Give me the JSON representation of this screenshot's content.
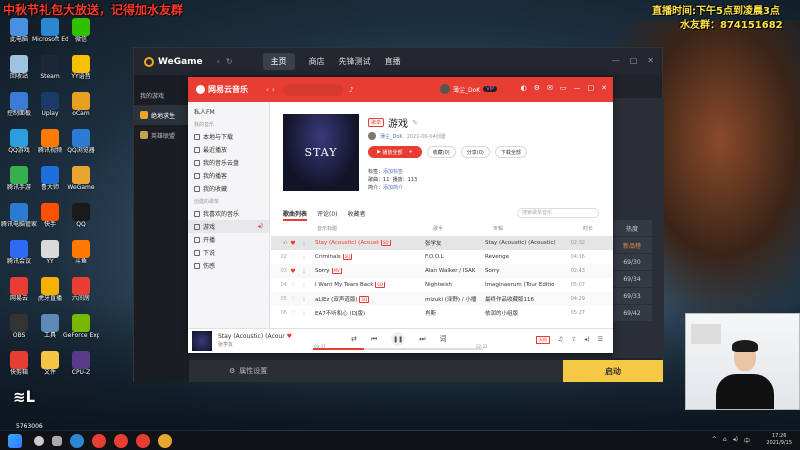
{
  "overlay": {
    "top_left": "中秋节礼包大放送，记得加水友群",
    "top_right_line1": "直播时间:下午5点到凌晨3点",
    "top_right_line2": "水友群：874151682"
  },
  "desktop_icons": [
    {
      "label": "此电脑",
      "icon": "computer-icon",
      "color": "#4a90e2"
    },
    {
      "label": "Microsoft Edge",
      "icon": "edge-icon",
      "color": "#2b87d1"
    },
    {
      "label": "微信",
      "icon": "wechat-icon",
      "color": "#2dc100"
    },
    {
      "label": "回收站",
      "icon": "recycle-bin-icon",
      "color": "#9ec3e0"
    },
    {
      "label": "Steam",
      "icon": "steam-icon",
      "color": "#1b2838"
    },
    {
      "label": "YY语音",
      "icon": "yy-icon",
      "color": "#f5c000"
    },
    {
      "label": "控制面板",
      "icon": "control-panel-icon",
      "color": "#3a7bd5"
    },
    {
      "label": "Uplay",
      "icon": "uplay-icon",
      "color": "#1a3a6a"
    },
    {
      "label": "oCam",
      "icon": "ocam-icon",
      "color": "#e8a020"
    },
    {
      "label": "QQ游戏",
      "icon": "qq-game-icon",
      "color": "#2a9ee0"
    },
    {
      "label": "腾讯视频",
      "icon": "tencent-video-icon",
      "color": "#ff7a00"
    },
    {
      "label": "QQ浏览器",
      "icon": "qq-browser-icon",
      "color": "#2b7bd5"
    },
    {
      "label": "腾讯手游",
      "icon": "tencent-mobile-game-icon",
      "color": "#36b04a"
    },
    {
      "label": "鲁大师",
      "icon": "ludashi-icon",
      "color": "#1e6fd9"
    },
    {
      "label": "WeGame",
      "icon": "wegame-icon",
      "color": "#e8a530"
    },
    {
      "label": "腾讯电脑管家",
      "icon": "pc-manager-icon",
      "color": "#2b7bd5"
    },
    {
      "label": "快手",
      "icon": "kuaishou-icon",
      "color": "#ff5000"
    },
    {
      "label": "QQ",
      "icon": "qq-icon",
      "color": "#1a1a1a"
    },
    {
      "label": "腾讯会议",
      "icon": "meeting-icon",
      "color": "#2d6bf5"
    },
    {
      "label": "YY",
      "icon": "yy2-icon",
      "color": "#d9d9d9"
    },
    {
      "label": "斗鱼",
      "icon": "douyu-icon",
      "color": "#ff7a00"
    },
    {
      "label": "网易云",
      "icon": "netease-icon",
      "color": "#e83d33"
    },
    {
      "label": "虎牙直播",
      "icon": "huya-icon",
      "color": "#f5b000"
    },
    {
      "label": "六间房",
      "icon": "liujianfang-icon",
      "color": "#e83d33"
    },
    {
      "label": "OBS",
      "icon": "obs-icon",
      "color": "#333333"
    },
    {
      "label": "工具",
      "icon": "tool-icon",
      "color": "#5a8ab5"
    },
    {
      "label": "GeForce Experience",
      "icon": "geforce-icon",
      "color": "#76b900"
    },
    {
      "label": "快剪辑",
      "icon": "clip-icon",
      "color": "#e83d33"
    },
    {
      "label": "文件",
      "icon": "folder-icon",
      "color": "#f5c544"
    },
    {
      "label": "CPU-Z",
      "icon": "cpuz-icon",
      "color": "#5a3a8a"
    }
  ],
  "wegame": {
    "logo": "WeGame",
    "nav": [
      "主页",
      "商店",
      "先锋测试",
      "直播"
    ],
    "sidebar": [
      "我的游戏",
      "绝地求生",
      "英雄联盟"
    ],
    "bottom_label": "属性设置",
    "start_label": "启动",
    "rank_labels": [
      "热度",
      "新品榜",
      "69/30",
      "69/34",
      "69/33",
      "69/42"
    ]
  },
  "netease": {
    "title": "网易云音乐",
    "user": "薄尘_DoK",
    "vip": "VIP",
    "left_menu": {
      "top": [
        {
          "label": "私人FM"
        }
      ],
      "section1_caption": "我的音乐",
      "section1": [
        "本地与下载",
        "最近播放",
        "我的音乐云盘",
        "我的播客",
        "我的收藏"
      ],
      "section2_caption": "创建的歌单",
      "section2": [
        "我喜欢的音乐",
        "游戏",
        "开播",
        "下说",
        "伤感"
      ]
    },
    "playlist": {
      "tag": "歌单",
      "title": "游戏",
      "owner": "薄尘_DoK",
      "created": "2021-06-04创建",
      "cover_text": "STAY",
      "play_all": "播放全部",
      "collect": "收藏(0)",
      "share": "分享(0)",
      "download": "下载全部",
      "tags_label": "标签",
      "tags_value": "添加标签",
      "songs_label": "歌曲",
      "songs_count": "11",
      "plays_label": "播放",
      "plays_count": "113",
      "desc_label": "简介",
      "desc_value": "添加简介"
    },
    "tabs": [
      "歌曲列表",
      "评论(0)",
      "收藏者"
    ],
    "search_placeholder": "搜索歌单音乐",
    "columns": [
      "音乐标题",
      "歌手",
      "专辑",
      "时长"
    ],
    "songs": [
      {
        "idx": "",
        "title": "Stay (Acoustic) (Acoust",
        "sq": "SQ",
        "artist": "张学友",
        "album": "Stay (Acoustic) (Acoustic)",
        "duration": "02:32",
        "liked": true,
        "playing": true
      },
      {
        "idx": "02",
        "title": "Criminals",
        "sq": "SQ",
        "artist": "F.O.O.L",
        "album": "Revenge",
        "duration": "04:16",
        "liked": false
      },
      {
        "idx": "03",
        "title": "Sorry",
        "sq": "MV",
        "artist": "Alan Walker / ISÁK",
        "album": "Sorry",
        "duration": "02:43",
        "liked": true
      },
      {
        "idx": "04",
        "title": "I Want My Tears Back",
        "sq": "SQ",
        "artist": "Nightwish",
        "album": "Imaginaerum (Tour Edition)",
        "duration": "05:07",
        "liked": false
      },
      {
        "idx": "05",
        "title": "aLIEz (双声道版)",
        "sq": "SQ",
        "artist": "mizuki (泽野) / 小播",
        "album": "最终作品收藏版116",
        "duration": "04:29",
        "liked": false
      },
      {
        "idx": "06",
        "title": "EA7不听和心 (DJ版)",
        "sq": "",
        "artist": "肖斯",
        "album": "依润的小组版",
        "duration": "05:27",
        "liked": false
      }
    ],
    "player": {
      "title": "Stay (Acoustic) (Acour",
      "artist": "张学友",
      "time_now": "00:47",
      "time_total": "02:32",
      "quality": "无损",
      "progress": 0.3
    }
  },
  "taskbar": {
    "time": "17:26",
    "date": "2021/9/15",
    "badge": "5763006"
  }
}
